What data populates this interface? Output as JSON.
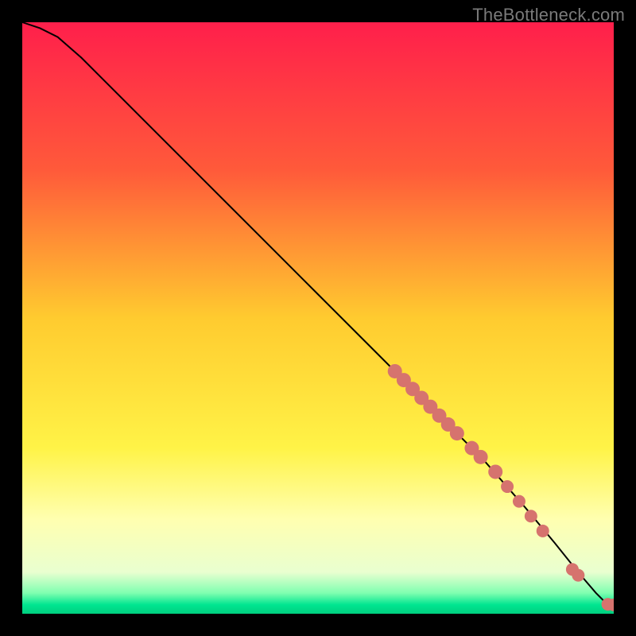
{
  "watermark": "TheBottleneck.com",
  "chart_data": {
    "type": "line",
    "title": "",
    "xlabel": "",
    "ylabel": "",
    "xlim": [
      0,
      100
    ],
    "ylim": [
      0,
      100
    ],
    "grid": false,
    "legend": false,
    "background_gradient_stops": [
      {
        "pos": 0.0,
        "color": "#ff1f4b"
      },
      {
        "pos": 0.25,
        "color": "#ff5a3a"
      },
      {
        "pos": 0.5,
        "color": "#ffcb2f"
      },
      {
        "pos": 0.72,
        "color": "#fff347"
      },
      {
        "pos": 0.84,
        "color": "#ffffb0"
      },
      {
        "pos": 0.93,
        "color": "#e9ffd0"
      },
      {
        "pos": 0.965,
        "color": "#7fffb0"
      },
      {
        "pos": 0.985,
        "color": "#00e590"
      },
      {
        "pos": 1.0,
        "color": "#00cf7f"
      }
    ],
    "curve": {
      "x": [
        0,
        3,
        6,
        10,
        20,
        30,
        40,
        50,
        60,
        70,
        78,
        85,
        90,
        94,
        97,
        99,
        100
      ],
      "y": [
        100,
        99,
        97.5,
        94,
        84,
        74,
        64,
        54,
        44,
        34,
        26,
        18,
        12,
        7,
        3.5,
        1.5,
        1.2
      ]
    },
    "marker_color": "#d6736e",
    "markers": {
      "x": [
        63,
        64.5,
        66,
        67.5,
        69,
        70.5,
        72,
        73.5,
        76,
        77.5,
        80,
        82,
        84,
        86,
        88,
        93,
        94,
        99,
        100
      ],
      "y": [
        41,
        39.5,
        38,
        36.5,
        35,
        33.5,
        32,
        30.5,
        28,
        26.5,
        24,
        21.5,
        19,
        16.5,
        14,
        7.5,
        6.5,
        1.6,
        1.5
      ]
    }
  }
}
